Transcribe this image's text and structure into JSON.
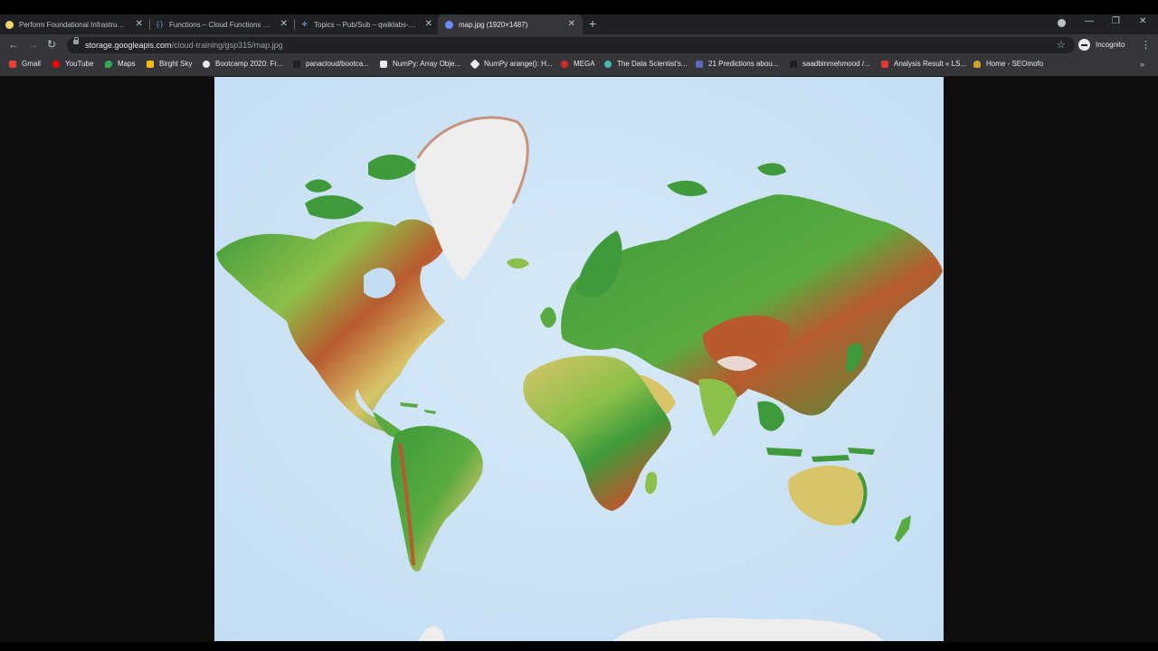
{
  "tabs": [
    {
      "title": "Perform Foundational Infrastructure",
      "favicon_color": "#f3d36b",
      "active": false
    },
    {
      "title": "Functions – Cloud Functions – qw",
      "favicon_color": "#8ab4f8",
      "active": false
    },
    {
      "title": "Topics – Pub/Sub – qwiklabs-gcp",
      "favicon_color": "#8ab4f8",
      "active": false
    },
    {
      "title": "map.jpg (1920×1487)",
      "favicon_color": "#6f8cff",
      "active": true
    }
  ],
  "toolbar": {
    "url_host": "storage.googleapis.com",
    "url_path": "/cloud-training/gsp315/map.jpg",
    "incognito_label": "Incognito"
  },
  "bookmarks": [
    {
      "label": "Gmail",
      "color": "#ea4335"
    },
    {
      "label": "YouTube",
      "color": "#ff0000"
    },
    {
      "label": "Maps",
      "color": "#34a853"
    },
    {
      "label": "Birght Sky",
      "color": "#fbbc04"
    },
    {
      "label": "Bootcamp 2020: Fr...",
      "color": "#e8eaed"
    },
    {
      "label": "panacloud/bootca...",
      "color": "#202124"
    },
    {
      "label": "NumPy: Array Obje...",
      "color": "#e8eaed"
    },
    {
      "label": "NumPy arange(): H...",
      "color": "#e8eaed"
    },
    {
      "label": "MEGA",
      "color": "#d9272e"
    },
    {
      "label": "The Data Scientist's...",
      "color": "#4db6ac"
    },
    {
      "label": "21 Predictions abou...",
      "color": "#5c6bc0"
    },
    {
      "label": "saadbinmehmood /...",
      "color": "#202124"
    },
    {
      "label": "Analysis Result « LS...",
      "color": "#e53935"
    },
    {
      "label": "Home - SEOmofo",
      "color": "#c9a227"
    }
  ],
  "colors": {
    "ocean": "#c3ddf2",
    "ocean_shallow": "#d7e9f7",
    "lowland": "#3e9a3a",
    "plain": "#8cc04a",
    "upland": "#d9c46a",
    "mountain": "#b85a2e",
    "ice": "#eeeeee"
  },
  "map": {
    "alt": "map.jpg (1920×1487)"
  }
}
